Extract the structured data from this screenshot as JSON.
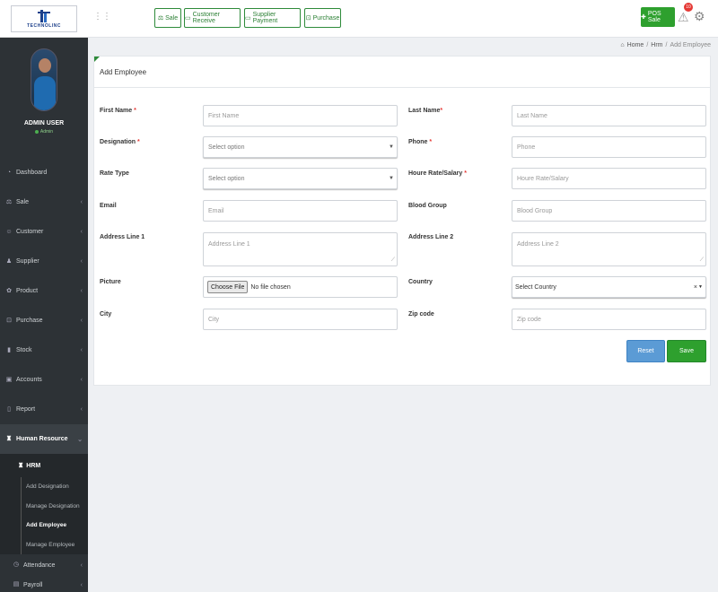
{
  "brand": {
    "logo_text": "TECHNOLINC"
  },
  "profile": {
    "name": "ADMIN USER",
    "role": "Admin"
  },
  "sidebar": {
    "items": [
      {
        "label": "Dashboard",
        "icon": "dashboard-icon"
      },
      {
        "label": "Sale",
        "icon": "scale-icon"
      },
      {
        "label": "Customer",
        "icon": "customer-icon"
      },
      {
        "label": "Supplier",
        "icon": "supplier-icon"
      },
      {
        "label": "Product",
        "icon": "product-icon"
      },
      {
        "label": "Purchase",
        "icon": "cart-icon"
      },
      {
        "label": "Stock",
        "icon": "chart-icon"
      },
      {
        "label": "Accounts",
        "icon": "accounts-icon"
      },
      {
        "label": "Report",
        "icon": "report-icon"
      },
      {
        "label": "Human Resource",
        "icon": "users-icon"
      }
    ],
    "hrm": {
      "label": "HRM",
      "items": [
        "Add Designation",
        "Manage Designation",
        "Add Employee",
        "Manage Employee"
      ]
    },
    "after": [
      {
        "label": "Attendance",
        "icon": "clock-icon"
      },
      {
        "label": "Payroll",
        "icon": "payroll-icon"
      }
    ]
  },
  "topbar": {
    "quick_links": [
      "Sale",
      "Customer Receive",
      "Supplier Payment",
      "Purchase"
    ],
    "pos_button": "POS Sale",
    "notification_count": "10"
  },
  "breadcrumb": {
    "home": "Home",
    "section": "Hrm",
    "current": "Add Employee"
  },
  "form": {
    "title": "Add Employee",
    "first_name": {
      "label": "First Name",
      "placeholder": "First Name"
    },
    "last_name": {
      "label": "Last Name",
      "placeholder": "Last Name"
    },
    "designation": {
      "label": "Designation",
      "value": "Select option"
    },
    "phone": {
      "label": "Phone",
      "placeholder": "Phone"
    },
    "rate_type": {
      "label": "Rate Type",
      "value": "Select option"
    },
    "houre_rate": {
      "label": "Houre Rate/Salary",
      "placeholder": "Houre Rate/Salary"
    },
    "email": {
      "label": "Email",
      "placeholder": "Email"
    },
    "blood_group": {
      "label": "Blood Group",
      "placeholder": "Blood Group"
    },
    "address1": {
      "label": "Address Line 1",
      "placeholder": "Address Line 1"
    },
    "address2": {
      "label": "Address Line 2",
      "placeholder": "Address Line 2"
    },
    "picture": {
      "label": "Picture",
      "button": "Choose File",
      "status": "No file chosen"
    },
    "country": {
      "label": "Country",
      "value": "Select Country"
    },
    "city": {
      "label": "City",
      "placeholder": "City"
    },
    "zip": {
      "label": "Zip code",
      "placeholder": "Zip code"
    },
    "reset_label": "Reset",
    "save_label": "Save"
  }
}
